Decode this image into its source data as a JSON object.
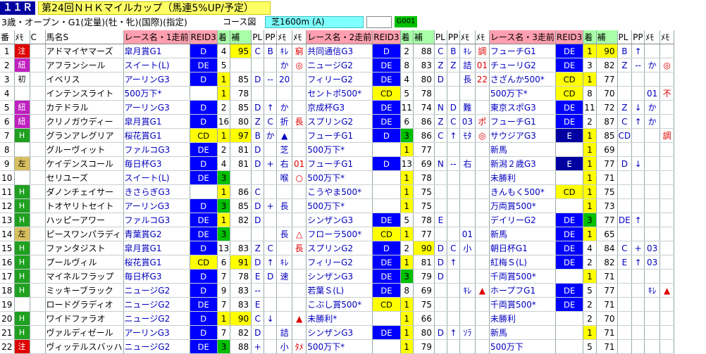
{
  "header": {
    "race_no": "１１Ｒ",
    "race_title": "第24回ＮＨＫマイルカップ（馬連5%UP/予定）",
    "conditions": "3歳・オープン・G1(定量)(牡・牝)(国際)(指定)",
    "course_label": "コース図",
    "course_value": "芝1600m (A)",
    "code": "G001"
  },
  "columns": {
    "num": "番",
    "memo": "ﾒﾓ",
    "c": "C",
    "name": "馬名S",
    "prev1": "レース名・1走前",
    "prev2": "レース名・2走前",
    "prev3": "レース名・3走前",
    "pci": "REID3",
    "chaku": "着",
    "ho": "補",
    "pl": "PL",
    "pp": "PP",
    "me": "ﾒﾓ",
    "memo2": "ﾒﾓ"
  },
  "rows": [
    {
      "no": "1",
      "mark": "注",
      "mc": "red",
      "name": "アドマイヤマーズ",
      "r1": {
        "race": "皐月賞G1",
        "run": "D",
        "rc": "D",
        "pos": "4",
        "pc": "n",
        "ho": "95",
        "hy": true,
        "pl": "C",
        "pp": "B",
        "me": "ｷﾚ",
        "m2": "窮"
      },
      "r2": {
        "race": "共同通信G3",
        "run": "D",
        "rc": "D",
        "pos": "2",
        "pc": "n",
        "ho": "88",
        "hy": false,
        "pl": "C",
        "pp": "B",
        "me": "ｷﾚ",
        "m2": "調"
      },
      "r3": {
        "race": "フューチG1",
        "run": "DE",
        "rc": "DE",
        "pos": "1",
        "pc": "y",
        "ho": "90",
        "hy": true,
        "pl": "B",
        "pp": "↑",
        "me": "",
        "m2": ""
      }
    },
    {
      "no": "2",
      "mark": "紐",
      "mc": "purple",
      "name": "アフランシール",
      "r1": {
        "race": "スイート(L)",
        "run": "DE",
        "rc": "DE",
        "pos": "5",
        "pc": "n",
        "ho": "",
        "hy": false,
        "pl": "",
        "pp": "",
        "me": "か",
        "m2": "◎"
      },
      "r2": {
        "race": "ニュージG2",
        "run": "DE",
        "rc": "DE",
        "pos": "8",
        "pc": "n",
        "ho": "83",
        "hy": false,
        "pl": "Z",
        "pp": "Z",
        "me": "詰",
        "m2": "01"
      },
      "r3": {
        "race": "チューリG2",
        "run": "DE",
        "rc": "DE",
        "pos": "3",
        "pc": "n",
        "ho": "82",
        "hy": false,
        "pl": "Z",
        "pp": "--",
        "me": "か",
        "m2": "◎"
      }
    },
    {
      "no": "3",
      "mark": "初",
      "mc": "none",
      "name": "イベリス",
      "r1": {
        "race": "アーリンG3",
        "run": "D",
        "rc": "D",
        "pos": "1",
        "pc": "y",
        "ho": "85",
        "hy": false,
        "pl": "D",
        "pp": "--",
        "me": "20",
        "m2": ""
      },
      "r2": {
        "race": "フィリーG2",
        "run": "DE",
        "rc": "DE",
        "pos": "4",
        "pc": "n",
        "ho": "80",
        "hy": false,
        "pl": "D",
        "pp": "",
        "me": "長",
        "m2": "22"
      },
      "r3": {
        "race": "さざんか500*",
        "run": "CD",
        "rc": "CD",
        "pos": "1",
        "pc": "y",
        "ho": "77",
        "hy": false,
        "pl": "",
        "pp": "",
        "me": "",
        "m2": ""
      }
    },
    {
      "no": "4",
      "mark": "",
      "mc": "none",
      "name": "インテンスライト",
      "r1": {
        "race": "500万下*",
        "run": "",
        "rc": "",
        "pos": "1",
        "pc": "y",
        "ho": "78",
        "hy": false,
        "pl": "",
        "pp": "",
        "me": "",
        "m2": ""
      },
      "r2": {
        "race": "セントポ500*",
        "run": "CD",
        "rc": "CD",
        "pos": "5",
        "pc": "n",
        "ho": "78",
        "hy": false,
        "pl": "",
        "pp": "",
        "me": "",
        "m2": ""
      },
      "r3": {
        "race": "500万下*",
        "run": "CD",
        "rc": "CD",
        "pos": "8",
        "pc": "n",
        "ho": "70",
        "hy": false,
        "pl": "",
        "pp": "",
        "me": "01",
        "m2": "不"
      }
    },
    {
      "no": "5",
      "mark": "紐",
      "mc": "purple",
      "name": "カテドラル",
      "r1": {
        "race": "アーリンG3",
        "run": "D",
        "rc": "D",
        "pos": "2",
        "pc": "n",
        "ho": "85",
        "hy": false,
        "pl": "D",
        "pp": "↑",
        "me": "か",
        "m2": ""
      },
      "r2": {
        "race": "京成杯G3",
        "run": "DE",
        "rc": "DE",
        "pos": "11",
        "pc": "n",
        "ho": "74",
        "hy": false,
        "pl": "N",
        "pp": "D",
        "me": "難",
        "m2": ""
      },
      "r3": {
        "race": "東京スポG3",
        "run": "DE",
        "rc": "DE",
        "pos": "11",
        "pc": "n",
        "ho": "72",
        "hy": false,
        "pl": "Z",
        "pp": "↓",
        "me": "か",
        "m2": ""
      }
    },
    {
      "no": "6",
      "mark": "紐",
      "mc": "purple",
      "name": "クリノガウディー",
      "r1": {
        "race": "皐月賞G1",
        "run": "D",
        "rc": "D",
        "pos": "16",
        "pc": "n",
        "ho": "80",
        "hy": false,
        "pl": "Z",
        "pp": "C",
        "me": "折",
        "m2": "長"
      },
      "r2": {
        "race": "スプリンG2",
        "run": "DE",
        "rc": "DE",
        "pos": "6",
        "pc": "n",
        "ho": "86",
        "hy": false,
        "pl": "Z",
        "pp": "C",
        "me": "03",
        "m2": "ポ"
      },
      "r3": {
        "race": "フューチG1",
        "run": "DE",
        "rc": "DE",
        "pos": "2",
        "pc": "n",
        "ho": "87",
        "hy": false,
        "pl": "C",
        "pp": "↑",
        "me": "か",
        "m2": ""
      }
    },
    {
      "no": "7",
      "mark": "H",
      "mc": "green",
      "name": "グランアレグリア",
      "r1": {
        "race": "桜花賞G1",
        "run": "CD",
        "rc": "CD",
        "pos": "1",
        "pc": "y",
        "ho": "97",
        "hy": true,
        "pl": "B",
        "pp": "か",
        "me": "▲",
        "m2": ""
      },
      "r2": {
        "race": "フューチG1",
        "run": "D",
        "rc": "D",
        "pos": "3",
        "pc": "g",
        "ho": "86",
        "hy": false,
        "pl": "C",
        "pp": "↑",
        "me": "ﾓﾀ",
        "m2": "◎"
      },
      "r3": {
        "race": "サウジアG3",
        "run": "E",
        "rc": "E",
        "pos": "1",
        "pc": "y",
        "ho": "85",
        "hy": false,
        "pl": "CD",
        "pp": "",
        "me": "",
        "m2": "調"
      }
    },
    {
      "no": "8",
      "mark": "",
      "mc": "none",
      "name": "グルーヴィット",
      "r1": {
        "race": "ファルコG3",
        "run": "DE",
        "rc": "DE",
        "pos": "2",
        "pc": "n",
        "ho": "81",
        "hy": false,
        "pl": "D",
        "pp": "",
        "me": "芝",
        "m2": ""
      },
      "r2": {
        "race": "500万下*",
        "run": "",
        "rc": "",
        "pos": "1",
        "pc": "y",
        "ho": "77",
        "hy": false,
        "pl": "",
        "pp": "",
        "me": "",
        "m2": ""
      },
      "r3": {
        "race": "新馬",
        "run": "",
        "rc": "",
        "pos": "1",
        "pc": "y",
        "ho": "69",
        "hy": false,
        "pl": "",
        "pp": "",
        "me": "",
        "m2": ""
      }
    },
    {
      "no": "9",
      "mark": "左",
      "mc": "tan",
      "name": "ケイデンスコール",
      "r1": {
        "race": "毎日杯G3",
        "run": "D",
        "rc": "D",
        "pos": "4",
        "pc": "n",
        "ho": "81",
        "hy": false,
        "pl": "D",
        "pp": "+",
        "me": "右",
        "m2": "01"
      },
      "r2": {
        "race": "フューチG1",
        "run": "D",
        "rc": "D",
        "pos": "13",
        "pc": "n",
        "ho": "69",
        "hy": false,
        "pl": "N",
        "pp": "--",
        "me": "右",
        "m2": ""
      },
      "r3": {
        "race": "新潟２歳G3",
        "run": "E",
        "rc": "E",
        "pos": "1",
        "pc": "y",
        "ho": "77",
        "hy": false,
        "pl": "D",
        "pp": "↓",
        "me": "",
        "m2": ""
      }
    },
    {
      "no": "10",
      "mark": "",
      "mc": "none",
      "name": "セリユーズ",
      "r1": {
        "race": "スイート(L)",
        "run": "DE",
        "rc": "DE",
        "pos": "3",
        "pc": "g",
        "ho": "",
        "hy": false,
        "pl": "",
        "pp": "",
        "me": "喉",
        "m2": "○"
      },
      "r2": {
        "race": "500万下*",
        "run": "",
        "rc": "",
        "pos": "1",
        "pc": "y",
        "ho": "78",
        "hy": false,
        "pl": "",
        "pp": "",
        "me": "",
        "m2": ""
      },
      "r3": {
        "race": "未勝利",
        "run": "",
        "rc": "",
        "pos": "1",
        "pc": "y",
        "ho": "71",
        "hy": false,
        "pl": "",
        "pp": "",
        "me": "",
        "m2": ""
      }
    },
    {
      "no": "11",
      "mark": "H",
      "mc": "green",
      "name": "ダノンチェイサー",
      "r1": {
        "race": "きさらぎG3",
        "run": "",
        "rc": "",
        "pos": "1",
        "pc": "y",
        "ho": "86",
        "hy": false,
        "pl": "C",
        "pp": "",
        "me": "",
        "m2": ""
      },
      "r2": {
        "race": "こうやま500*",
        "run": "",
        "rc": "",
        "pos": "1",
        "pc": "y",
        "ho": "75",
        "hy": false,
        "pl": "",
        "pp": "",
        "me": "",
        "m2": ""
      },
      "r3": {
        "race": "きんもく500*",
        "run": "CD",
        "rc": "CD",
        "pos": "1",
        "pc": "y",
        "ho": "75",
        "hy": false,
        "pl": "",
        "pp": "",
        "me": "",
        "m2": ""
      }
    },
    {
      "no": "12",
      "mark": "H",
      "mc": "green",
      "name": "トオヤリトセイト",
      "r1": {
        "race": "アーリンG3",
        "run": "D",
        "rc": "D",
        "pos": "3",
        "pc": "g",
        "ho": "85",
        "hy": false,
        "pl": "D",
        "pp": "+",
        "me": "長",
        "m2": ""
      },
      "r2": {
        "race": "500万下*",
        "run": "",
        "rc": "",
        "pos": "1",
        "pc": "y",
        "ho": "75",
        "hy": false,
        "pl": "",
        "pp": "",
        "me": "",
        "m2": ""
      },
      "r3": {
        "race": "万両賞500*",
        "run": "",
        "rc": "",
        "pos": "1",
        "pc": "y",
        "ho": "73",
        "hy": false,
        "pl": "",
        "pp": "",
        "me": "",
        "m2": ""
      }
    },
    {
      "no": "13",
      "mark": "H",
      "mc": "green",
      "name": "ハッピーアワー",
      "r1": {
        "race": "ファルコG3",
        "run": "DE",
        "rc": "DE",
        "pos": "1",
        "pc": "y",
        "ho": "82",
        "hy": false,
        "pl": "D",
        "pp": "",
        "me": "",
        "m2": ""
      },
      "r2": {
        "race": "シンザンG3",
        "run": "DE",
        "rc": "DE",
        "pos": "5",
        "pc": "n",
        "ho": "78",
        "hy": false,
        "pl": "E",
        "pp": "",
        "me": "",
        "m2": ""
      },
      "r3": {
        "race": "デイリーG2",
        "run": "DE",
        "rc": "DE",
        "pos": "3",
        "pc": "g",
        "ho": "77",
        "hy": false,
        "pl": "DE",
        "pp": "↑",
        "me": "",
        "m2": ""
      }
    },
    {
      "no": "14",
      "mark": "左",
      "mc": "tan",
      "name": "ピースワンパラディ",
      "r1": {
        "race": "青葉賞G2",
        "run": "DE",
        "rc": "DE",
        "pos": "3",
        "pc": "g",
        "ho": "",
        "hy": false,
        "pl": "",
        "pp": "",
        "me": "長",
        "m2": "△"
      },
      "r2": {
        "race": "フローラ500*",
        "run": "CD",
        "rc": "CD",
        "pos": "1",
        "pc": "y",
        "ho": "77",
        "hy": false,
        "pl": "",
        "pp": "",
        "me": "01",
        "m2": ""
      },
      "r3": {
        "race": "新馬",
        "run": "DE",
        "rc": "DE",
        "pos": "1",
        "pc": "y",
        "ho": "65",
        "hy": false,
        "pl": "",
        "pp": "",
        "me": "",
        "m2": ""
      }
    },
    {
      "no": "15",
      "mark": "H",
      "mc": "green",
      "name": "ファンタジスト",
      "r1": {
        "race": "皐月賞G1",
        "run": "D",
        "rc": "D",
        "pos": "13",
        "pc": "n",
        "ho": "83",
        "hy": false,
        "pl": "Z",
        "pp": "C",
        "me": "",
        "m2": "長"
      },
      "r2": {
        "race": "スプリンG2",
        "run": "D",
        "rc": "D",
        "pos": "2",
        "pc": "n",
        "ho": "90",
        "hy": true,
        "pl": "D",
        "pp": "C",
        "me": "小",
        "m2": ""
      },
      "r3": {
        "race": "朝日杯G1",
        "run": "DE",
        "rc": "DE",
        "pos": "4",
        "pc": "n",
        "ho": "84",
        "hy": false,
        "pl": "C",
        "pp": "+",
        "me": "03",
        "m2": ""
      }
    },
    {
      "no": "16",
      "mark": "H",
      "mc": "green",
      "name": "プールヴィル",
      "r1": {
        "race": "桜花賞G1",
        "run": "CD",
        "rc": "CD",
        "pos": "6",
        "pc": "n",
        "ho": "91",
        "hy": true,
        "pl": "D",
        "pp": "↑",
        "me": "ｷﾚ",
        "m2": ""
      },
      "r2": {
        "race": "フィリーG2",
        "run": "DE",
        "rc": "DE",
        "pos": "1",
        "pc": "y",
        "ho": "81",
        "hy": false,
        "pl": "D",
        "pp": "↑",
        "me": "",
        "m2": ""
      },
      "r3": {
        "race": "紅梅Ｓ(L)",
        "run": "DE",
        "rc": "DE",
        "pos": "2",
        "pc": "n",
        "ho": "82",
        "hy": false,
        "pl": "E",
        "pp": "↑",
        "me": "03",
        "m2": ""
      }
    },
    {
      "no": "17",
      "mark": "H",
      "mc": "green",
      "name": "マイネルフラップ",
      "r1": {
        "race": "毎日杯G3",
        "run": "D",
        "rc": "D",
        "pos": "7",
        "pc": "n",
        "ho": "78",
        "hy": false,
        "pl": "E",
        "pp": "D",
        "me": "速",
        "m2": ""
      },
      "r2": {
        "race": "シンザンG3",
        "run": "DE",
        "rc": "DE",
        "pos": "3",
        "pc": "g",
        "ho": "79",
        "hy": false,
        "pl": "D",
        "pp": "",
        "me": "",
        "m2": ""
      },
      "r3": {
        "race": "千両賞500*",
        "run": "",
        "rc": "",
        "pos": "1",
        "pc": "y",
        "ho": "71",
        "hy": false,
        "pl": "",
        "pp": "",
        "me": "",
        "m2": ""
      }
    },
    {
      "no": "18",
      "mark": "H",
      "mc": "green",
      "name": "ミッキーブラック",
      "r1": {
        "race": "ニュージG2",
        "run": "D",
        "rc": "D",
        "pos": "9",
        "pc": "n",
        "ho": "83",
        "hy": false,
        "pl": "--",
        "pp": "",
        "me": "",
        "m2": ""
      },
      "r2": {
        "race": "若葉Ｓ(L)",
        "run": "DE",
        "rc": "DE",
        "pos": "8",
        "pc": "n",
        "ho": "69",
        "hy": false,
        "pl": "",
        "pp": "",
        "me": "ｷﾚ",
        "m2": "▲"
      },
      "r3": {
        "race": "ホープフG1",
        "run": "DE",
        "rc": "DE",
        "pos": "5",
        "pc": "n",
        "ho": "77",
        "hy": false,
        "pl": "",
        "pp": "",
        "me": "ｷﾚ",
        "m2": "▲"
      }
    },
    {
      "no": "19",
      "mark": "",
      "mc": "none",
      "name": "ロードグラディオ",
      "r1": {
        "race": "ニュージG2",
        "run": "DE",
        "rc": "DE",
        "pos": "7",
        "pc": "n",
        "ho": "83",
        "hy": false,
        "pl": "E",
        "pp": "",
        "me": "",
        "m2": ""
      },
      "r2": {
        "race": "こぶし賞500*",
        "run": "CD",
        "rc": "CD",
        "pos": "1",
        "pc": "y",
        "ho": "75",
        "hy": false,
        "pl": "",
        "pp": "",
        "me": "",
        "m2": ""
      },
      "r3": {
        "race": "千両賞500*",
        "run": "DE",
        "rc": "DE",
        "pos": "2",
        "pc": "n",
        "ho": "71",
        "hy": false,
        "pl": "",
        "pp": "",
        "me": "",
        "m2": ""
      }
    },
    {
      "no": "20",
      "mark": "H",
      "mc": "green",
      "name": "ワイドファラオ",
      "r1": {
        "race": "ニュージG2",
        "run": "D",
        "rc": "D",
        "pos": "1",
        "pc": "y",
        "ho": "90",
        "hy": true,
        "pl": "C",
        "pp": "↓",
        "me": "",
        "m2": "▲"
      },
      "r2": {
        "race": "未勝利*",
        "run": "",
        "rc": "",
        "pos": "1",
        "pc": "y",
        "ho": "66",
        "hy": false,
        "pl": "",
        "pp": "",
        "me": "",
        "m2": ""
      },
      "r3": {
        "race": "未勝利",
        "run": "",
        "rc": "",
        "pos": "2",
        "pc": "n",
        "ho": "70",
        "hy": false,
        "pl": "",
        "pp": "",
        "me": "",
        "m2": ""
      }
    },
    {
      "no": "21",
      "mark": "H",
      "mc": "green",
      "name": "ヴァルディゼール",
      "r1": {
        "race": "アーリンG3",
        "run": "D",
        "rc": "D",
        "pos": "7",
        "pc": "n",
        "ho": "82",
        "hy": false,
        "pl": "D",
        "pp": "",
        "me": "詰",
        "m2": ""
      },
      "r2": {
        "race": "シンザンG3",
        "run": "DE",
        "rc": "DE",
        "pos": "1",
        "pc": "y",
        "ho": "80",
        "hy": false,
        "pl": "D",
        "pp": "↑",
        "me": "ｿﾗ",
        "m2": ""
      },
      "r3": {
        "race": "新馬",
        "run": "",
        "rc": "",
        "pos": "1",
        "pc": "y",
        "ho": "71",
        "hy": false,
        "pl": "",
        "pp": "",
        "me": "",
        "m2": ""
      }
    },
    {
      "no": "22",
      "mark": "注",
      "mc": "red",
      "name": "ヴィッテルスバッハ",
      "r1": {
        "race": "ニュージG2",
        "run": "DE",
        "rc": "DE",
        "pos": "3",
        "pc": "g",
        "ho": "88",
        "hy": false,
        "pl": "+",
        "pp": "",
        "me": "小",
        "m2": "ﾀﾒ"
      },
      "r2": {
        "race": "500万下*",
        "run": "",
        "rc": "",
        "pos": "1",
        "pc": "y",
        "ho": "79",
        "hy": false,
        "pl": "",
        "pp": "",
        "me": "",
        "m2": ""
      },
      "r3": {
        "race": "500万下",
        "run": "",
        "rc": "",
        "pos": "5",
        "pc": "n",
        "ho": "71",
        "hy": false,
        "pl": "",
        "pp": "",
        "me": "",
        "m2": ""
      }
    }
  ]
}
